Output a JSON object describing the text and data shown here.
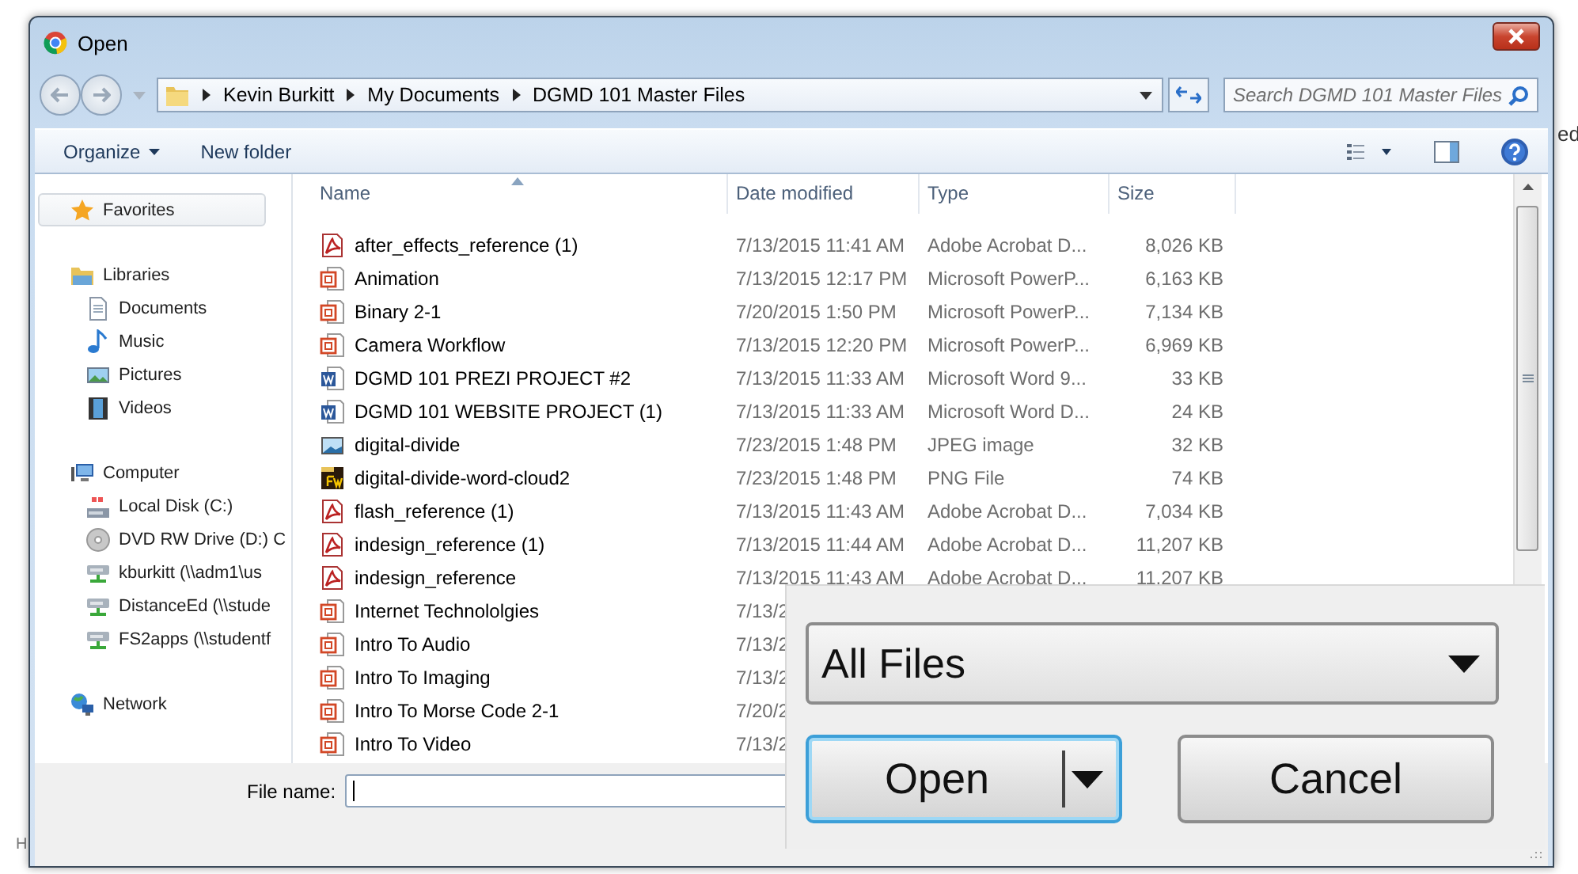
{
  "window": {
    "title": "Open"
  },
  "breadcrumb": [
    "Kevin Burkitt",
    "My Documents",
    "DGMD 101 Master Files"
  ],
  "search": {
    "placeholder": "Search DGMD 101 Master Files"
  },
  "toolbar": {
    "organize": "Organize",
    "new_folder": "New folder"
  },
  "sidebar": [
    {
      "label": "Favorites",
      "kind": "star",
      "selected": true
    },
    {
      "label": "Libraries",
      "kind": "library",
      "selected": false,
      "children": [
        {
          "label": "Documents",
          "kind": "document",
          "selected": false
        },
        {
          "label": "Music",
          "kind": "music",
          "selected": false
        },
        {
          "label": "Pictures",
          "kind": "pictures",
          "selected": false
        },
        {
          "label": "Videos",
          "kind": "videos",
          "selected": false
        }
      ]
    },
    {
      "label": "Computer",
      "kind": "computer",
      "selected": false,
      "children": [
        {
          "label": "Local Disk (C:)",
          "kind": "disk",
          "selected": false
        },
        {
          "label": "DVD RW Drive (D:) C",
          "kind": "dvd",
          "selected": false
        },
        {
          "label": "kburkitt (\\\\adm1\\us",
          "kind": "netdrive",
          "selected": false
        },
        {
          "label": "DistanceEd (\\\\stude",
          "kind": "netdrive",
          "selected": false
        },
        {
          "label": "FS2apps (\\\\studentf",
          "kind": "netdrive",
          "selected": false
        }
      ]
    },
    {
      "label": "Network",
      "kind": "network",
      "selected": false
    }
  ],
  "columns": [
    "Name",
    "Date modified",
    "Type",
    "Size"
  ],
  "files": [
    {
      "kind": "pdf",
      "name": "after_effects_reference (1)",
      "date": "7/13/2015 11:41 AM",
      "type": "Adobe Acrobat D...",
      "size": "8,026 KB"
    },
    {
      "kind": "ppt",
      "name": "Animation",
      "date": "7/13/2015 12:17 PM",
      "type": "Microsoft PowerP...",
      "size": "6,163 KB"
    },
    {
      "kind": "ppt",
      "name": "Binary 2-1",
      "date": "7/20/2015 1:50 PM",
      "type": "Microsoft PowerP...",
      "size": "7,134 KB"
    },
    {
      "kind": "ppt",
      "name": "Camera Workflow",
      "date": "7/13/2015 12:20 PM",
      "type": "Microsoft PowerP...",
      "size": "6,969 KB"
    },
    {
      "kind": "word",
      "name": "DGMD 101 PREZI PROJECT #2",
      "date": "7/13/2015 11:33 AM",
      "type": "Microsoft Word 9...",
      "size": "33 KB"
    },
    {
      "kind": "word",
      "name": "DGMD 101 WEBSITE PROJECT (1)",
      "date": "7/13/2015 11:33 AM",
      "type": "Microsoft Word D...",
      "size": "24 KB"
    },
    {
      "kind": "image",
      "name": "digital-divide",
      "date": "7/23/2015 1:48 PM",
      "type": "JPEG image",
      "size": "32 KB"
    },
    {
      "kind": "fw",
      "name": "digital-divide-word-cloud2",
      "date": "7/23/2015 1:48 PM",
      "type": "PNG File",
      "size": "74 KB"
    },
    {
      "kind": "pdf",
      "name": "flash_reference (1)",
      "date": "7/13/2015 11:43 AM",
      "type": "Adobe Acrobat D...",
      "size": "7,034 KB"
    },
    {
      "kind": "pdf",
      "name": "indesign_reference (1)",
      "date": "7/13/2015 11:44 AM",
      "type": "Adobe Acrobat D...",
      "size": "11,207 KB"
    },
    {
      "kind": "pdf",
      "name": "indesign_reference",
      "date": "7/13/2015 11:43 AM",
      "type": "Adobe Acrobat D...",
      "size": "11,207 KB"
    },
    {
      "kind": "ppt",
      "name": "Internet Technololgies",
      "date": "7/13/2"
    },
    {
      "kind": "ppt",
      "name": "Intro To Audio",
      "date": "7/13/2"
    },
    {
      "kind": "ppt",
      "name": "Intro To Imaging",
      "date": "7/13/2"
    },
    {
      "kind": "ppt",
      "name": "Intro To Morse Code 2-1",
      "date": "7/20/2"
    },
    {
      "kind": "ppt",
      "name": "Intro To Video",
      "date": "7/13/2"
    }
  ],
  "file_name": {
    "label": "File name:"
  },
  "magnified": {
    "filter": "All Files",
    "open": "Open",
    "cancel": "Cancel"
  },
  "background_texts": [
    "ed",
    "H"
  ]
}
